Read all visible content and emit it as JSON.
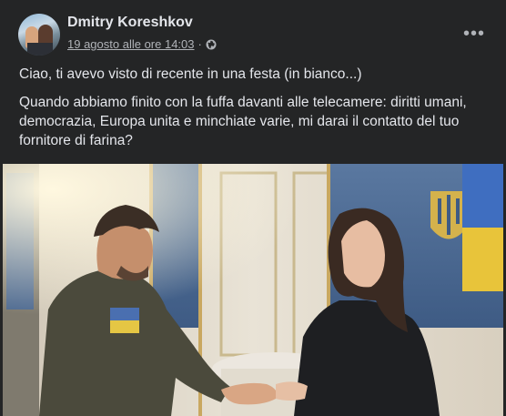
{
  "post": {
    "author": "Dmitry Koreshkov",
    "timestamp": "19 agosto alle ore 14:03",
    "separator": "·",
    "privacy_icon": "globe-icon",
    "more_icon": "more-options-icon",
    "more_label": "•••",
    "paragraphs": [
      "Ciao, ti avevo visto di recente in una festa (in bianco...)",
      "Quando abbiamo finito con la fuffa davanti alle telecamere:  diritti umani, democrazia,  Europa unita e minchiate varie, mi darai il contatto del tuo fornitore di farina?"
    ]
  },
  "colors": {
    "background": "#242526",
    "primary_text": "#e4e6eb",
    "secondary_text": "#b0b3b8"
  }
}
